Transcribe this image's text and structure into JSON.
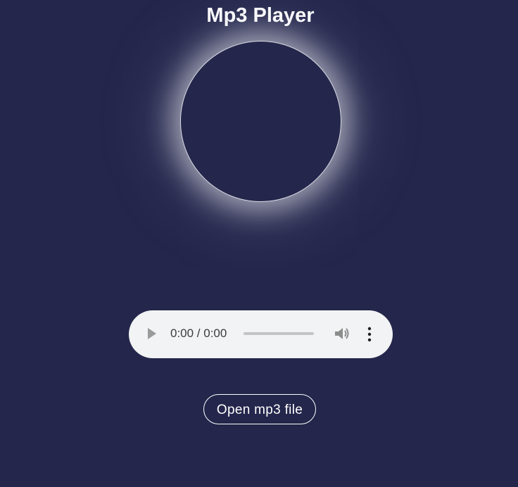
{
  "header": {
    "title": "Mp3 Player"
  },
  "player": {
    "time_display": "0:00 / 0:00",
    "progress": 0,
    "play_icon": "play-icon",
    "volume_icon": "volume-icon",
    "more_icon": "more-options-icon"
  },
  "actions": {
    "open_label": "Open mp3 file"
  },
  "colors": {
    "background": "#24264b",
    "text": "#ffffff",
    "player_background": "#f1f3f4"
  }
}
